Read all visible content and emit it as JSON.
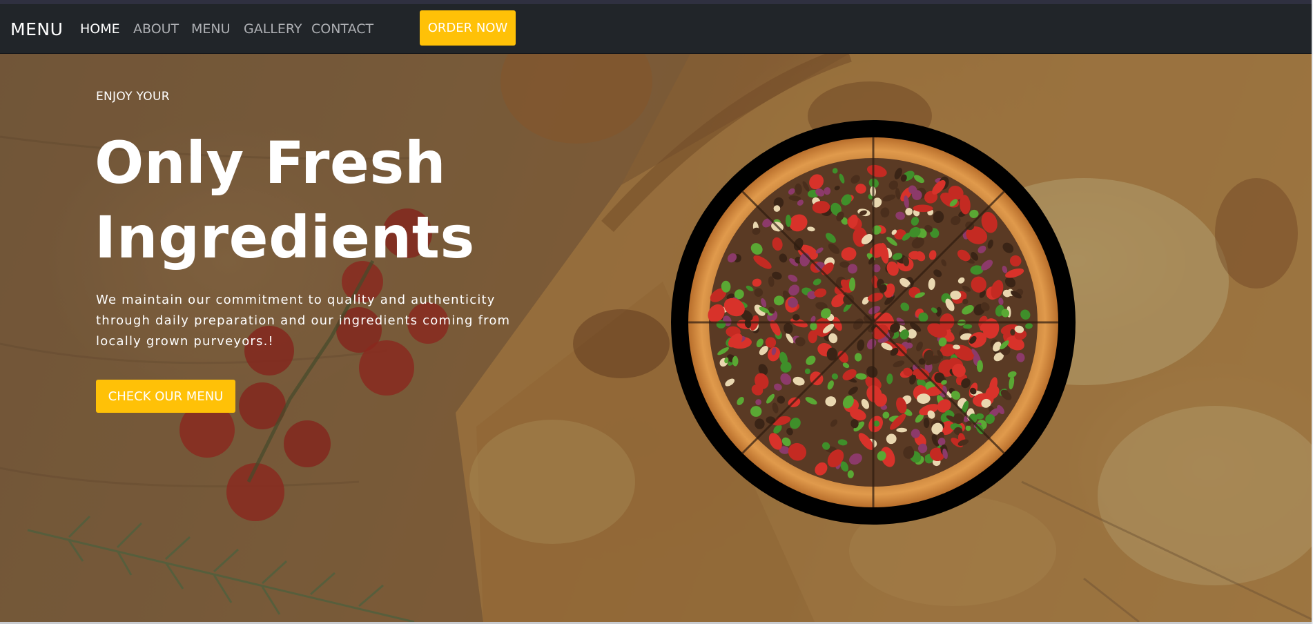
{
  "navbar": {
    "brand": "MENU",
    "links": [
      {
        "label": "HOME",
        "active": true
      },
      {
        "label": "ABOUT",
        "active": false
      },
      {
        "label": "MENU",
        "active": false
      },
      {
        "label": "GALLERY",
        "active": false
      },
      {
        "label": "CONTACT",
        "active": false
      }
    ],
    "cta_label": "ORDER NOW"
  },
  "hero": {
    "kicker": "ENJOY YOUR",
    "title_line1": "Only Fresh",
    "title_line2": "Ingredients",
    "description_line1": "We maintain our commitment to quality and authenticity",
    "description_line2": "through daily preparation and our ingredients coming from",
    "description_line3": "locally grown purveyors.!",
    "cta_label": "CHECK OUR MENU"
  },
  "colors": {
    "navbar_bg": "#212529",
    "accent": "#ffc107",
    "nav_active": "#ffffff",
    "nav_inactive": "#aeb0b4"
  },
  "icons": {
    "hero_background": "pizza-background-image",
    "featured_item": "pizza-image"
  }
}
